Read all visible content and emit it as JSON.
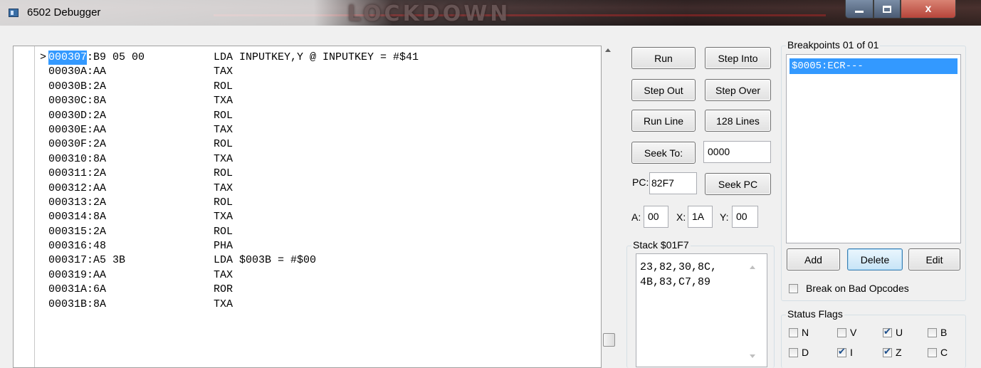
{
  "window": {
    "title": "6502 Debugger",
    "background_brand": "LOCKDOWN",
    "controls": {
      "minimize": "minimize",
      "maximize": "maximize",
      "close": "x"
    }
  },
  "disassembly": {
    "current_pointer": ">",
    "lines": [
      {
        "addr": "000307",
        "bytes": ":B9 05 00",
        "instr": "LDA INPUTKEY,Y @ INPUTKEY = #$41",
        "current": true
      },
      {
        "addr": "00030A",
        "bytes": ":AA",
        "instr": "TAX"
      },
      {
        "addr": "00030B",
        "bytes": ":2A",
        "instr": "ROL"
      },
      {
        "addr": "00030C",
        "bytes": ":8A",
        "instr": "TXA"
      },
      {
        "addr": "00030D",
        "bytes": ":2A",
        "instr": "ROL"
      },
      {
        "addr": "00030E",
        "bytes": ":AA",
        "instr": "TAX"
      },
      {
        "addr": "00030F",
        "bytes": ":2A",
        "instr": "ROL"
      },
      {
        "addr": "000310",
        "bytes": ":8A",
        "instr": "TXA"
      },
      {
        "addr": "000311",
        "bytes": ":2A",
        "instr": "ROL"
      },
      {
        "addr": "000312",
        "bytes": ":AA",
        "instr": "TAX"
      },
      {
        "addr": "000313",
        "bytes": ":2A",
        "instr": "ROL"
      },
      {
        "addr": "000314",
        "bytes": ":8A",
        "instr": "TXA"
      },
      {
        "addr": "000315",
        "bytes": ":2A",
        "instr": "ROL"
      },
      {
        "addr": "000316",
        "bytes": ":48",
        "instr": "PHA"
      },
      {
        "addr": "000317",
        "bytes": ":A5 3B",
        "instr": "LDA $003B = #$00"
      },
      {
        "addr": "000319",
        "bytes": ":AA",
        "instr": "TAX"
      },
      {
        "addr": "00031A",
        "bytes": ":6A",
        "instr": "ROR"
      },
      {
        "addr": "00031B",
        "bytes": ":8A",
        "instr": "TXA"
      }
    ]
  },
  "controls": {
    "run": "Run",
    "step_into": "Step Into",
    "step_out": "Step Out",
    "step_over": "Step Over",
    "run_line": "Run Line",
    "lines_128": "128 Lines",
    "seek_to": "Seek To:",
    "seek_to_value": "0000",
    "pc_label": "PC:",
    "pc_value": "82F7",
    "seek_pc": "Seek PC",
    "a_label": "A:",
    "a_value": "00",
    "x_label": "X:",
    "x_value": "1A",
    "y_label": "Y:",
    "y_value": "00"
  },
  "stack": {
    "label": "Stack $01F7",
    "lines": [
      "23,82,30,8C,",
      "4B,83,C7,89"
    ]
  },
  "breakpoints": {
    "label": "Breakpoints 01 of 01",
    "items": [
      "$0005:ECR---"
    ],
    "add": "Add",
    "delete": "Delete",
    "edit": "Edit",
    "break_on_bad_opcodes": "Break on Bad Opcodes",
    "break_on_bad_opcodes_checked": false
  },
  "status_flags": {
    "label": "Status Flags",
    "flags": [
      {
        "name": "N",
        "checked": false
      },
      {
        "name": "V",
        "checked": false
      },
      {
        "name": "U",
        "checked": true
      },
      {
        "name": "B",
        "checked": false
      },
      {
        "name": "D",
        "checked": false
      },
      {
        "name": "I",
        "checked": true
      },
      {
        "name": "Z",
        "checked": true
      },
      {
        "name": "C",
        "checked": false
      }
    ]
  },
  "colors": {
    "selection": "#3399ff",
    "window_bg": "#f0f0f0"
  }
}
